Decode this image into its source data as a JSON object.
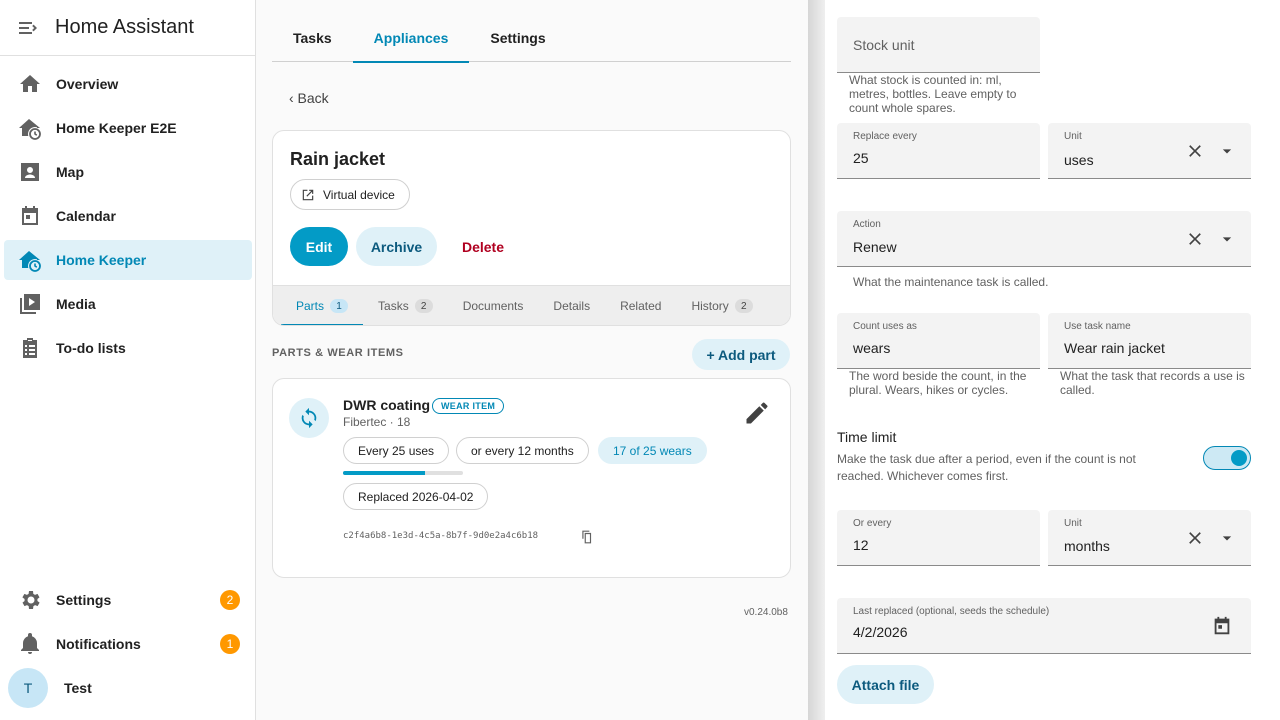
{
  "sidebar": {
    "title": "Home Assistant",
    "items": [
      {
        "label": "Overview"
      },
      {
        "label": "Home Keeper E2E"
      },
      {
        "label": "Map"
      },
      {
        "label": "Calendar"
      },
      {
        "label": "Home Keeper"
      },
      {
        "label": "Media"
      },
      {
        "label": "To-do lists"
      }
    ],
    "settings": {
      "label": "Settings",
      "badge": "2"
    },
    "notifications": {
      "label": "Notifications",
      "badge": "1"
    },
    "user": {
      "initial": "T",
      "name": "Test"
    }
  },
  "main": {
    "tabs": [
      "Tasks",
      "Appliances",
      "Settings"
    ],
    "back_label": "‹ Back",
    "appliance": {
      "name": "Rain jacket",
      "device_chip": "Virtual device",
      "edit_label": "Edit",
      "archive_label": "Archive",
      "delete_label": "Delete",
      "sub_tabs": [
        {
          "label": "Parts",
          "count": "1"
        },
        {
          "label": "Tasks",
          "count": "2"
        },
        {
          "label": "Documents"
        },
        {
          "label": "Details"
        },
        {
          "label": "Related"
        },
        {
          "label": "History",
          "count": "2"
        }
      ]
    },
    "parts_section_label": "PARTS & WEAR ITEMS",
    "add_part_label": "+ Add part",
    "part": {
      "name": "DWR coating",
      "badge": "WEAR ITEM",
      "subtitle": "Fibertec · 18",
      "chips": [
        "Every 25 uses",
        "or every 12 months",
        "17 of 25 wears"
      ],
      "progress": 0.68,
      "replaced_chip": "Replaced 2026-04-02",
      "id": "c2f4a6b8-1e3d-4c5a-8b7f-9d0e2a4c6b18"
    },
    "version": "v0.24.0b8"
  },
  "panel": {
    "stock_unit": {
      "placeholder": "Stock unit",
      "helper": "What stock is counted in: ml, metres, bottles. Leave empty to count whole spares."
    },
    "replace_every": {
      "label": "Replace every",
      "value": "25"
    },
    "replace_unit": {
      "label": "Unit",
      "value": "uses"
    },
    "action": {
      "label": "Action",
      "value": "Renew",
      "helper": "What the maintenance task is called."
    },
    "count_uses_as": {
      "label": "Count uses as",
      "value": "wears",
      "helper": "The word beside the count, in the plural. Wears, hikes or cycles."
    },
    "use_task_name": {
      "label": "Use task name",
      "value": "Wear rain jacket",
      "helper": "What the task that records a use is called."
    },
    "time_limit": {
      "title": "Time limit",
      "description": "Make the task due after a period, even if the count is not reached. Whichever comes first.",
      "enabled": true
    },
    "or_every": {
      "label": "Or every",
      "value": "12"
    },
    "time_unit": {
      "label": "Unit",
      "value": "months"
    },
    "last_replaced": {
      "label": "Last replaced (optional, seeds the schedule)",
      "value": "4/2/2026"
    },
    "attach_label": "Attach file"
  },
  "colors": {
    "accent": "#039bc6",
    "danger": "#b00020",
    "badge": "#ff9800"
  }
}
